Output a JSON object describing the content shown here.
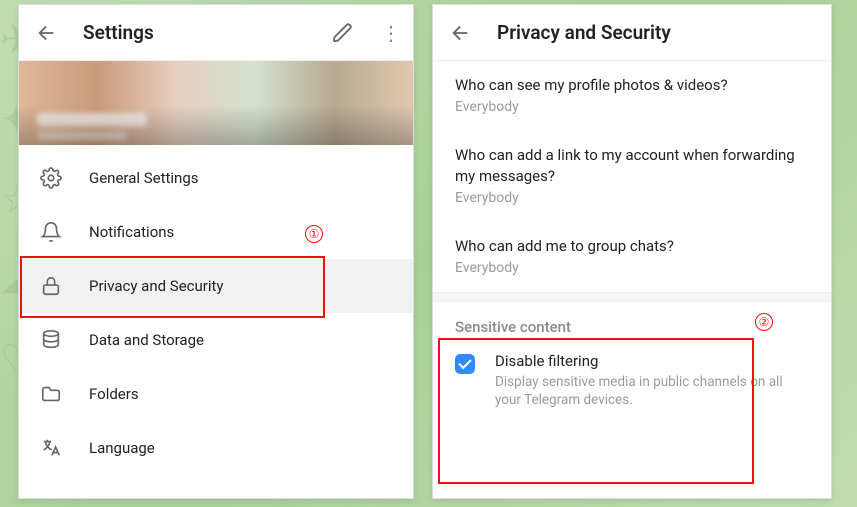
{
  "left": {
    "title": "Settings",
    "menu": {
      "general": "General Settings",
      "notifications": "Notifications",
      "privacy": "Privacy and Security",
      "data": "Data and Storage",
      "folders": "Folders",
      "language": "Language"
    }
  },
  "right": {
    "title": "Privacy and Security",
    "items": {
      "photos": {
        "q": "Who can see my profile photos & videos?",
        "a": "Everybody"
      },
      "forward": {
        "q": "Who can add a link to my account when forwarding my messages?",
        "a": "Everybody"
      },
      "groups": {
        "q": "Who can add me to group chats?",
        "a": "Everybody"
      }
    },
    "sensitive": {
      "section": "Sensitive content",
      "title": "Disable filtering",
      "desc": "Display sensitive media in public channels on all your Telegram devices.",
      "checked": true
    }
  },
  "annot": {
    "one": "①",
    "two": "②"
  }
}
